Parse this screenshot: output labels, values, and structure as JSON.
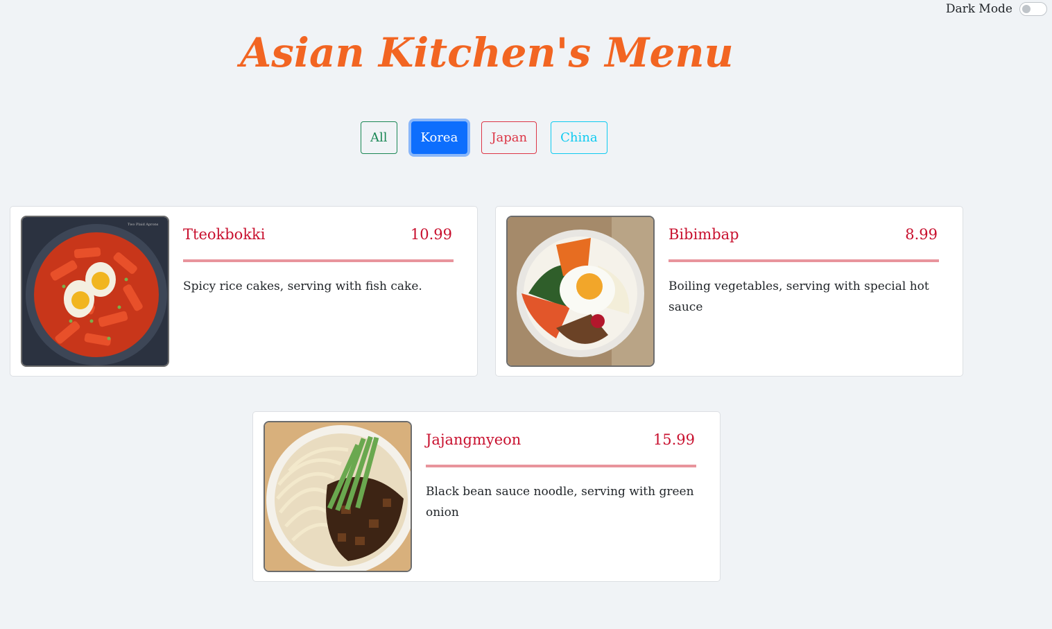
{
  "header": {
    "dark_mode_label": "Dark Mode",
    "title": "Asian Kitchen's Menu"
  },
  "filters": {
    "all": "All",
    "korea": "Korea",
    "japan": "Japan",
    "china": "China",
    "active": "Korea"
  },
  "menu": [
    {
      "name": "Tteokbokki",
      "price": "10.99",
      "description": "Spicy rice cakes, serving with fish cake.",
      "photo_credit": "Two Plaid Aprons"
    },
    {
      "name": "Bibimbap",
      "price": "8.99",
      "description": "Boiling vegetables, serving with special hot sauce"
    },
    {
      "name": "Jajangmyeon",
      "price": "15.99",
      "description": "Black bean sauce noodle, serving with green onion"
    }
  ],
  "colors": {
    "title": "#f26522",
    "item_name": "#c8102e",
    "active_filter": "#0d6efd"
  }
}
